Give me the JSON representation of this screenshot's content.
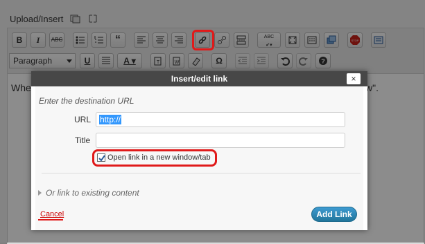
{
  "editor": {
    "upload_label": "Upload/Insert",
    "content_text_visible": "Whe",
    "content_tail_visible": "w\"."
  },
  "toolbar": {
    "row1_icons": [
      "bold",
      "italic",
      "strikethrough",
      "bullet-list",
      "numbered-list",
      "blockquote",
      "align-left",
      "align-center",
      "align-right",
      "insert-link",
      "unlink",
      "more-tag",
      "spellcheck",
      "fullscreen",
      "kitchen-sink",
      "show-hide",
      "stop",
      "wp-adv"
    ],
    "row2_icons": [
      "underline",
      "justify",
      "text-color",
      "paste-text",
      "paste-word",
      "remove-format",
      "special-char",
      "outdent",
      "indent",
      "undo",
      "redo",
      "help"
    ],
    "format_select": "Paragraph"
  },
  "dialog": {
    "title": "Insert/edit link",
    "close_label": "×",
    "hint": "Enter the destination URL",
    "url_label": "URL",
    "url_value": "http://",
    "title_label": "Title",
    "title_value": "",
    "open_new_window_label": "Open link in a new window/tab",
    "open_new_window_checked": true,
    "existing_content_label": "Or link to existing content",
    "cancel_label": "Cancel",
    "add_link_label": "Add Link"
  },
  "colors": {
    "highlight_red": "#e01a1a",
    "button_blue": "#21759b",
    "dialog_title_bg": "#474747"
  }
}
